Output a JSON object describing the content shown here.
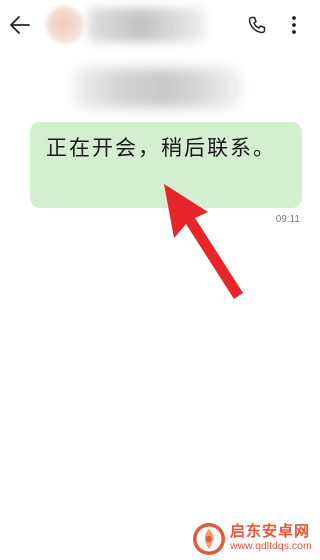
{
  "header": {
    "back_icon": "back-arrow-icon",
    "call_icon": "phone-icon",
    "more_icon": "more-vertical-icon"
  },
  "message": {
    "text": "正在开会，稍后联系。",
    "time": "09:11",
    "bubble_color": "#d4efd0"
  },
  "annotation": {
    "arrow_color": "#e8252a"
  },
  "watermark": {
    "name": "启东安卓网",
    "url": "www.qdltdqs.com",
    "color": "#e8563a"
  }
}
